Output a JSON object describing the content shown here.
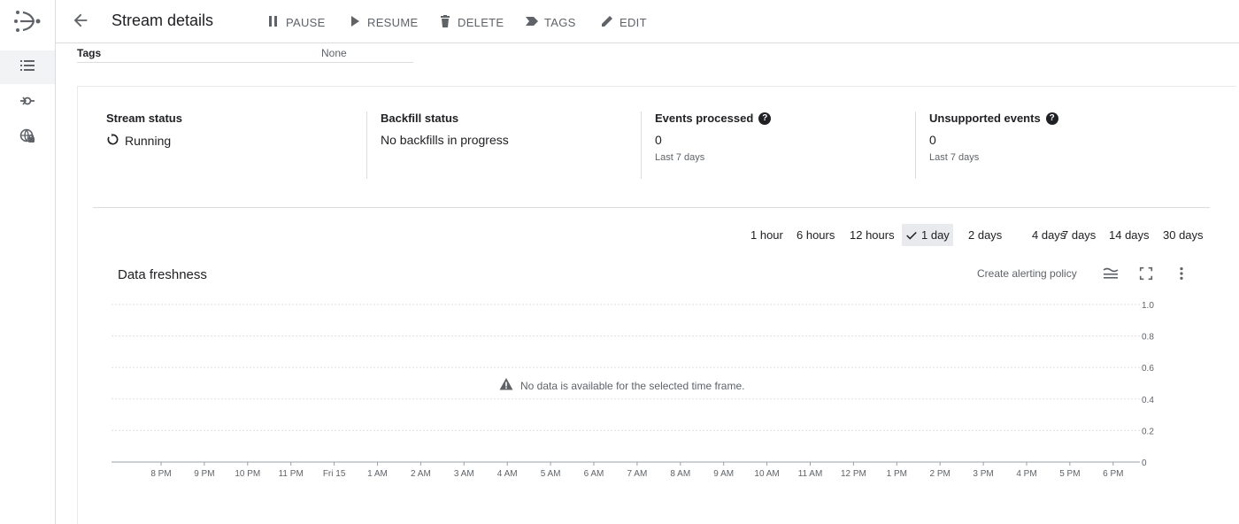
{
  "header": {
    "title": "Stream details",
    "actions": {
      "pause": "PAUSE",
      "resume": "RESUME",
      "delete": "DELETE",
      "tags": "TAGS",
      "edit": "EDIT"
    }
  },
  "rail": {
    "items": [
      "streams-icon",
      "connection-profiles-icon",
      "private-connectivity-icon"
    ]
  },
  "details": {
    "tags_label": "Tags",
    "tags_value": "None"
  },
  "stats": {
    "stream_status": {
      "label": "Stream status",
      "value": "Running"
    },
    "backfill_status": {
      "label": "Backfill status",
      "value": "No backfills in progress"
    },
    "events_processed": {
      "label": "Events processed",
      "value": "0",
      "sub": "Last 7 days"
    },
    "unsupported_events": {
      "label": "Unsupported events",
      "value": "0",
      "sub": "Last 7 days"
    }
  },
  "time_ranges": {
    "options": [
      "1 hour",
      "6 hours",
      "12 hours",
      "1 day",
      "2 days",
      "4 days",
      "7 days",
      "14 days",
      "30 days"
    ],
    "selected": "1 day"
  },
  "chart": {
    "title": "Data freshness",
    "alert_link": "Create alerting policy",
    "empty_message": "No data is available for the selected time frame."
  },
  "chart_data": {
    "type": "line",
    "title": "Data freshness",
    "xlabel": "",
    "ylabel": "",
    "x_ticks": [
      "8 PM",
      "9 PM",
      "10 PM",
      "11 PM",
      "Fri 15",
      "1 AM",
      "2 AM",
      "3 AM",
      "4 AM",
      "5 AM",
      "6 AM",
      "7 AM",
      "8 AM",
      "9 AM",
      "10 AM",
      "11 AM",
      "12 PM",
      "1 PM",
      "2 PM",
      "3 PM",
      "4 PM",
      "5 PM",
      "6 PM"
    ],
    "y_ticks": [
      "1.0",
      "0.8",
      "0.6",
      "0.4",
      "0.2",
      "0"
    ],
    "ylim": [
      0,
      1.0
    ],
    "series": [],
    "grid": true
  },
  "colors": {
    "text": "#202124",
    "muted": "#5f6368",
    "border": "#dadce0",
    "selected_bg": "#e8eaed"
  }
}
